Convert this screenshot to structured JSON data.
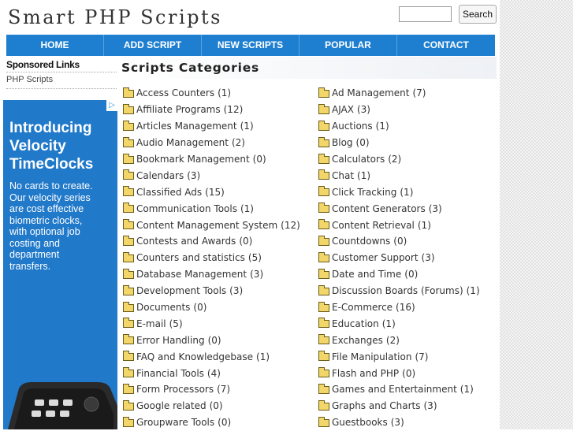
{
  "header": {
    "site_title": "Smart PHP Scripts",
    "search_placeholder": "",
    "search_button": "Search"
  },
  "nav": [
    {
      "label": "HOME"
    },
    {
      "label": "ADD SCRIPT"
    },
    {
      "label": "NEW SCRIPTS"
    },
    {
      "label": "POPULAR"
    },
    {
      "label": "CONTACT"
    }
  ],
  "sidebar": {
    "heading": "Sponsored Links",
    "link": "PHP Scripts"
  },
  "ad": {
    "headline": "Introducing\nVelocity\nTimeClocks",
    "body": "No cards to create.\nOur velocity series\nare cost effective\nbiometric clocks,\nwith optional job\ncosting and\ndepartment\ntransfers."
  },
  "categories": {
    "title": "Scripts Categories",
    "left": [
      {
        "name": "Access Counters",
        "count": "(1)"
      },
      {
        "name": "Affiliate Programs",
        "count": "(12)"
      },
      {
        "name": "Articles Management",
        "count": "(1)"
      },
      {
        "name": "Audio Management",
        "count": "(2)"
      },
      {
        "name": "Bookmark Management",
        "count": "(0)"
      },
      {
        "name": "Calendars",
        "count": "(3)"
      },
      {
        "name": "Classified Ads",
        "count": "(15)"
      },
      {
        "name": "Communication Tools",
        "count": "(1)"
      },
      {
        "name": "Content Management System",
        "count": "(12)"
      },
      {
        "name": "Contests and Awards",
        "count": "(0)"
      },
      {
        "name": "Counters and statistics",
        "count": "(5)"
      },
      {
        "name": "Database Management",
        "count": "(3)"
      },
      {
        "name": "Development Tools",
        "count": "(3)"
      },
      {
        "name": "Documents",
        "count": "(0)"
      },
      {
        "name": "E-mail",
        "count": "(5)"
      },
      {
        "name": "Error Handling",
        "count": "(0)"
      },
      {
        "name": "FAQ and Knowledgebase",
        "count": "(1)"
      },
      {
        "name": "Financial Tools",
        "count": "(4)"
      },
      {
        "name": "Form Processors",
        "count": "(7)"
      },
      {
        "name": "Google related",
        "count": "(0)"
      },
      {
        "name": "Groupware Tools",
        "count": "(0)"
      }
    ],
    "right": [
      {
        "name": "Ad Management",
        "count": "(7)"
      },
      {
        "name": "AJAX",
        "count": "(3)"
      },
      {
        "name": "Auctions",
        "count": "(1)"
      },
      {
        "name": "Blog",
        "count": "(0)"
      },
      {
        "name": "Calculators",
        "count": "(2)"
      },
      {
        "name": "Chat",
        "count": "(1)"
      },
      {
        "name": "Click Tracking",
        "count": "(1)"
      },
      {
        "name": "Content Generators",
        "count": "(3)"
      },
      {
        "name": "Content Retrieval",
        "count": "(1)"
      },
      {
        "name": "Countdowns",
        "count": "(0)"
      },
      {
        "name": "Customer Support",
        "count": "(3)"
      },
      {
        "name": "Date and Time",
        "count": "(0)"
      },
      {
        "name": "Discussion Boards (Forums)",
        "count": "(1)"
      },
      {
        "name": "E-Commerce",
        "count": "(16)"
      },
      {
        "name": "Education",
        "count": "(1)"
      },
      {
        "name": "Exchanges",
        "count": "(2)"
      },
      {
        "name": "File Manipulation",
        "count": "(7)"
      },
      {
        "name": "Flash and PHP",
        "count": "(0)"
      },
      {
        "name": "Games and Entertainment",
        "count": "(1)"
      },
      {
        "name": "Graphs and Charts",
        "count": "(3)"
      },
      {
        "name": "Guestbooks",
        "count": "(3)"
      }
    ]
  }
}
